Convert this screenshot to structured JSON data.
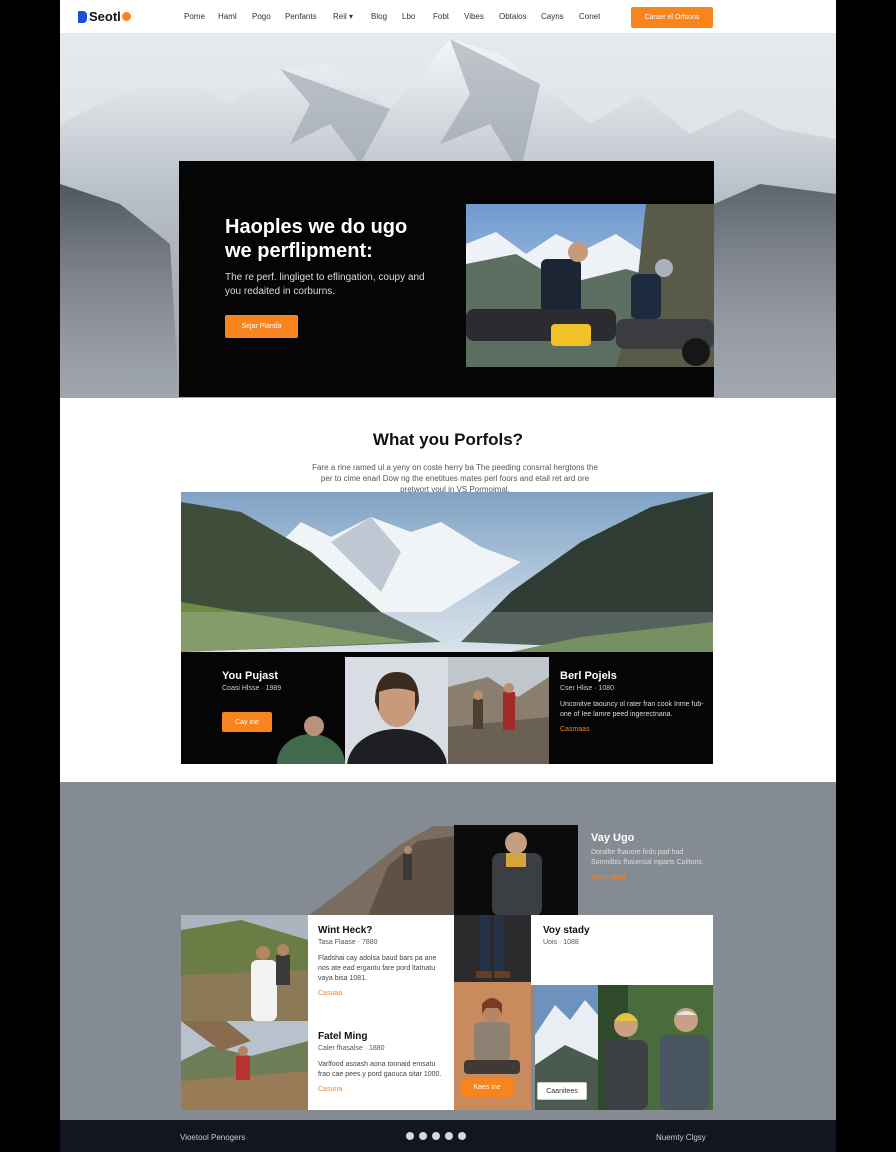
{
  "brand": {
    "name": "Seotl"
  },
  "nav": {
    "items": [
      "Pome",
      "Haml",
      "Pogo",
      "Penfants",
      "Reil",
      "Blog",
      "Lbo",
      "Fobt",
      "Vibes",
      "Obtaios",
      "Cayns",
      "Conet"
    ],
    "dropdown_marker": "▾",
    "cta": "Carser el Orfsons"
  },
  "hero": {
    "title_line1": "Haoples we do ugo",
    "title_line2": "we perflipment:",
    "subtitle": "The re perf. lingliget to eflingation, coupy and you redaited in corburns.",
    "button": "Sejar Planda"
  },
  "portfolio": {
    "title": "What you Porfols?",
    "body": "Fare a rine ramed ul a yeny on coste herry ba The peeding consrral hergtons the per to cime enarl Dow ng the enetitues mates perl foors and etail ret ard ore pretwort youl in VS Pormoimal."
  },
  "strip": {
    "left": {
      "title": "You Pujast",
      "meta": "Coasi Hlsse · 1989",
      "button": "Cay ine"
    },
    "right": {
      "title": "Berl Pojels",
      "meta": "Cser Hlise · 1080",
      "text": "Unconitve taouncy ol rater fran cook Inme fub-one of Iee lamre peed ingerectnana.",
      "link": "Casmaas"
    }
  },
  "feature": {
    "top_right": {
      "title": "Vay Ugo",
      "text": "Dorallte fhauore firds pad had Sonmilbis fhaumsal inparts Calitons.",
      "link": "Carry saga"
    },
    "card1": {
      "title": "Wint Heck?",
      "meta": "Tasa Flaase · 7880",
      "text": "Fladshai cay adolsa baud bars pa ane nos ate ead ergantu fare pord ltatnatu vaya bisa 1081.",
      "link": "Casuaa"
    },
    "card2": {
      "title": "Voy stady",
      "meta": "Uois · 1088"
    },
    "card3": {
      "title": "Fatel Ming",
      "meta": "Caler fhasalse · 1880",
      "text": "Varlfood asoash aona toonaid emsatu frao cae pees.y pord gaouca sitar 1000.",
      "link": "Casuna"
    },
    "tile_button": "Kaes ine",
    "small_button": "Caanitees"
  },
  "footer": {
    "left": "Vioetool Penogers",
    "right": "Nuemty Clgsy",
    "social_icons": [
      "camera-icon",
      "facebook-icon",
      "pinterest-icon",
      "vimeo-icon",
      "youtube-icon"
    ]
  },
  "colors": {
    "accent": "#f7841d",
    "dark": "#050505",
    "grey_band": "#858b93",
    "footer": "#111620"
  }
}
